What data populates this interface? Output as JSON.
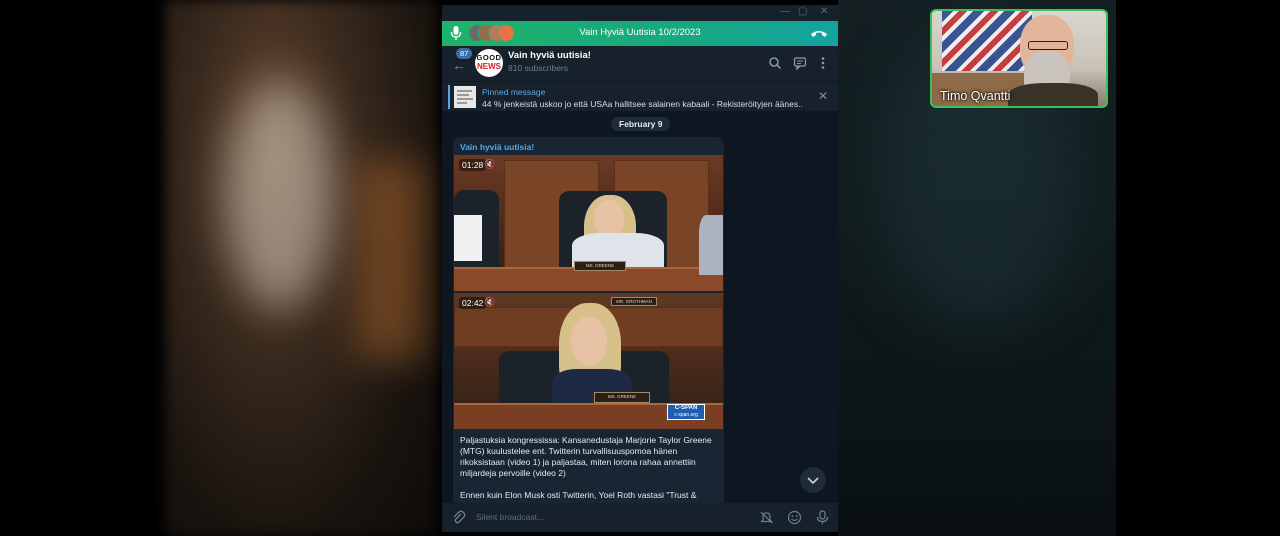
{
  "call": {
    "title": "Vain Hyviä Uutisia 10/2/2023"
  },
  "channel": {
    "unread_badge": "87",
    "logo_top": "GOOD",
    "logo_bottom": "NEWS",
    "name": "Vain hyviä uutisia!",
    "subscribers": "810 subscribers"
  },
  "pinned": {
    "title": "Pinned message",
    "text": "44 % jenkeistä uskoo jo että USAa hallitsee salainen kabaali - Rekisteröityjen äänes..."
  },
  "date_chip": "February 9",
  "message": {
    "sender": "Vain hyviä uutisia!",
    "video1": {
      "duration": "01:28",
      "nameplate": "MS. GREENE"
    },
    "video2": {
      "duration": "02:42",
      "nameplate": "MS. GREENE",
      "top_nameplate": "MR. GROTHMAN",
      "watermark_top": "C-SPAN",
      "watermark_bottom": "c-span.org"
    },
    "paragraph1": "Paljastuksia kongressissa: Kansanedustaja Marjorie Taylor Greene (MTG) kuulustelee ent. Twitterin turvallisuuspomoa hänen rikoksistaan (video 1) ja paljastaa, miten lorona rahaa annettiin miljardeja pervoille (video 2)",
    "paragraph2": "Ennen kuin Elon Musk osti Twitterin, Yoel Roth vastasi \"Trust & Safety\" -osastosta yhtiössä, kun lapsiporno oli kaikkialla"
  },
  "composer": {
    "placeholder": "Silent broadcast..."
  },
  "participant": {
    "name": "Timo Qvantti"
  },
  "colors": {
    "accent": "#5aa7e0",
    "call_green": "#1fb36a",
    "cam_border": "#3fbf5c"
  }
}
